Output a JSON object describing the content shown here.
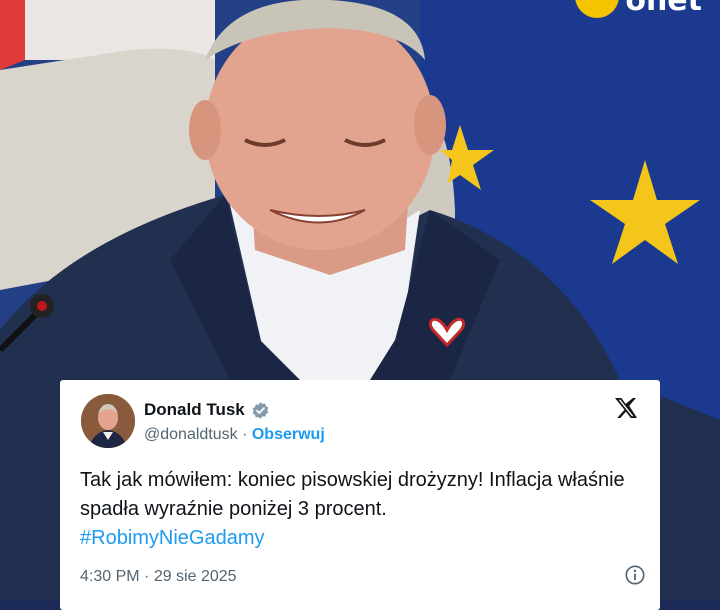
{
  "brand": {
    "logo_text": "onet",
    "accent": "#f5c400"
  },
  "tweet": {
    "author_name": "Donald Tusk",
    "handle": "@donaldtusk",
    "separator": " · ",
    "follow_label": "Obserwuj",
    "text": "Tak jak mówiłem: koniec pisowskiej drożyzny! Inflacja właśnie spadła wyraźnie poniżej 3 procent.",
    "hashtag": "#RobimyNieGadamy",
    "time": "4:30 PM",
    "date": "29 sie 2025",
    "verified": true
  },
  "colors": {
    "link": "#1d9bf0",
    "text": "#0f1419",
    "muted": "#536471",
    "eu_blue": "#1b3a8f",
    "eu_star": "#f4c61b"
  }
}
